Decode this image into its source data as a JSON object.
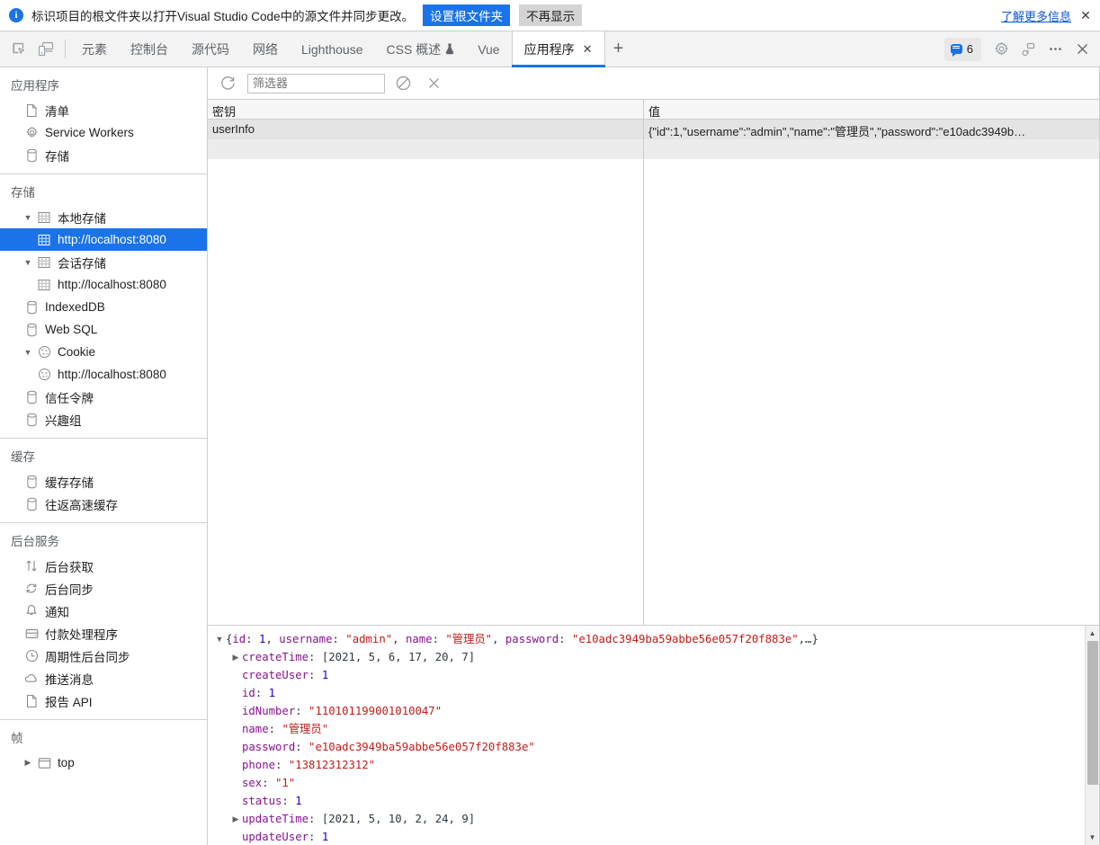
{
  "infobar": {
    "icon": "info-icon",
    "message": "标识项目的根文件夹以打开Visual Studio Code中的源文件并同步更改。",
    "primary_button": "设置根文件夹",
    "secondary_button": "不再显示",
    "link": "了解更多信息",
    "close": "✕",
    "accent_color": "#1a73e8"
  },
  "tabbar": {
    "inspect_icon": "inspect-element-icon",
    "device_icon": "device-toolbar-icon",
    "tabs": [
      {
        "label": "元素",
        "active": false
      },
      {
        "label": "控制台",
        "active": false
      },
      {
        "label": "源代码",
        "active": false
      },
      {
        "label": "网络",
        "active": false
      },
      {
        "label": "Lighthouse",
        "active": false
      },
      {
        "label": "CSS 概述",
        "active": false,
        "badge": "experiment-icon"
      },
      {
        "label": "Vue",
        "active": false
      },
      {
        "label": "应用程序",
        "active": true,
        "closable": true
      }
    ],
    "add_tab": "+",
    "message_count": "6",
    "settings_icon": "gear-icon",
    "customize_icon": "devices-pair-icon",
    "more_icon": "more-options-icon",
    "close_icon": "close-devtools-icon",
    "active_underline_color": "#1a73e8"
  },
  "sidebar": {
    "sections": [
      {
        "header": "应用程序",
        "items": [
          {
            "label": "清单",
            "icon": "manifest-document-icon",
            "indent": 1
          },
          {
            "label": "Service Workers",
            "icon": "gear-icon",
            "indent": 1
          },
          {
            "label": "存储",
            "icon": "database-icon",
            "indent": 1
          }
        ]
      },
      {
        "header": "存储",
        "items": [
          {
            "label": "本地存储",
            "icon": "table-icon",
            "indent": 1,
            "twisty": "expanded"
          },
          {
            "label": "http://localhost:8080",
            "icon": "table-icon",
            "indent": 2,
            "selected": true
          },
          {
            "label": "会话存储",
            "icon": "table-icon",
            "indent": 1,
            "twisty": "expanded"
          },
          {
            "label": "http://localhost:8080",
            "icon": "table-icon",
            "indent": 2
          },
          {
            "label": "IndexedDB",
            "icon": "database-icon",
            "indent": 1
          },
          {
            "label": "Web SQL",
            "icon": "database-icon",
            "indent": 1
          },
          {
            "label": "Cookie",
            "icon": "cookie-icon",
            "indent": 1,
            "twisty": "expanded"
          },
          {
            "label": "http://localhost:8080",
            "icon": "cookie-icon",
            "indent": 2
          },
          {
            "label": "信任令牌",
            "icon": "database-icon",
            "indent": 1
          },
          {
            "label": "兴趣组",
            "icon": "database-icon",
            "indent": 1
          }
        ]
      },
      {
        "header": "缓存",
        "items": [
          {
            "label": "缓存存储",
            "icon": "database-icon",
            "indent": 1
          },
          {
            "label": "往返高速缓存",
            "icon": "database-icon",
            "indent": 1
          }
        ]
      },
      {
        "header": "后台服务",
        "items": [
          {
            "label": "后台获取",
            "icon": "arrows-updown-icon",
            "indent": 1
          },
          {
            "label": "后台同步",
            "icon": "sync-icon",
            "indent": 1
          },
          {
            "label": "通知",
            "icon": "bell-icon",
            "indent": 1
          },
          {
            "label": "付款处理程序",
            "icon": "credit-card-icon",
            "indent": 1
          },
          {
            "label": "周期性后台同步",
            "icon": "clock-icon",
            "indent": 1
          },
          {
            "label": "推送消息",
            "icon": "cloud-icon",
            "indent": 1
          },
          {
            "label": "报告 API",
            "icon": "document-icon",
            "indent": 1
          }
        ]
      },
      {
        "header": "帧",
        "items": [
          {
            "label": "top",
            "icon": "frame-icon",
            "indent": 1,
            "twisty": "collapsed"
          }
        ]
      }
    ]
  },
  "storage_toolbar": {
    "refresh_icon": "refresh-icon",
    "filter_placeholder": "筛选器",
    "filter_value": "",
    "clear_all_icon": "clear-all-icon",
    "delete_selected_icon": "delete-selected-icon"
  },
  "datagrid": {
    "columns": [
      "密钥",
      "值"
    ],
    "rows": [
      {
        "key": "userInfo",
        "value": "{\"id\":1,\"username\":\"admin\",\"name\":\"管理员\",\"password\":\"e10adc3949b…",
        "selected": true
      }
    ]
  },
  "preview": {
    "summary_prefix": "{id: ",
    "summary": [
      {
        "t": "p",
        "v": "{"
      },
      {
        "t": "k",
        "v": "id"
      },
      {
        "t": "p",
        "v": ": "
      },
      {
        "t": "n",
        "v": "1"
      },
      {
        "t": "p",
        "v": ", "
      },
      {
        "t": "k",
        "v": "username"
      },
      {
        "t": "p",
        "v": ": "
      },
      {
        "t": "s",
        "v": "\"admin\""
      },
      {
        "t": "p",
        "v": ", "
      },
      {
        "t": "k",
        "v": "name"
      },
      {
        "t": "p",
        "v": ": "
      },
      {
        "t": "s",
        "v": "\"管理员\""
      },
      {
        "t": "p",
        "v": ", "
      },
      {
        "t": "k",
        "v": "password"
      },
      {
        "t": "p",
        "v": ": "
      },
      {
        "t": "s",
        "v": "\"e10adc3949ba59abbe56e057f20f883e\""
      },
      {
        "t": "p",
        "v": ",…}"
      }
    ],
    "properties": [
      {
        "twisty": "collapsed",
        "name": "createTime",
        "value": "[2021, 5, 6, 17, 20, 7]",
        "type": "array"
      },
      {
        "twisty": "none",
        "name": "createUser",
        "value": "1",
        "type": "number"
      },
      {
        "twisty": "none",
        "name": "id",
        "value": "1",
        "type": "number"
      },
      {
        "twisty": "none",
        "name": "idNumber",
        "value": "\"110101199001010047\"",
        "type": "string"
      },
      {
        "twisty": "none",
        "name": "name",
        "value": "\"管理员\"",
        "type": "string"
      },
      {
        "twisty": "none",
        "name": "password",
        "value": "\"e10adc3949ba59abbe56e057f20f883e\"",
        "type": "string"
      },
      {
        "twisty": "none",
        "name": "phone",
        "value": "\"13812312312\"",
        "type": "string"
      },
      {
        "twisty": "none",
        "name": "sex",
        "value": "\"1\"",
        "type": "string"
      },
      {
        "twisty": "none",
        "name": "status",
        "value": "1",
        "type": "number"
      },
      {
        "twisty": "collapsed",
        "name": "updateTime",
        "value": "[2021, 5, 10, 2, 24, 9]",
        "type": "array"
      },
      {
        "twisty": "none",
        "name": "updateUser",
        "value": "1",
        "type": "number"
      }
    ],
    "scrollbar": {
      "up": "▲",
      "down": "▼"
    }
  }
}
